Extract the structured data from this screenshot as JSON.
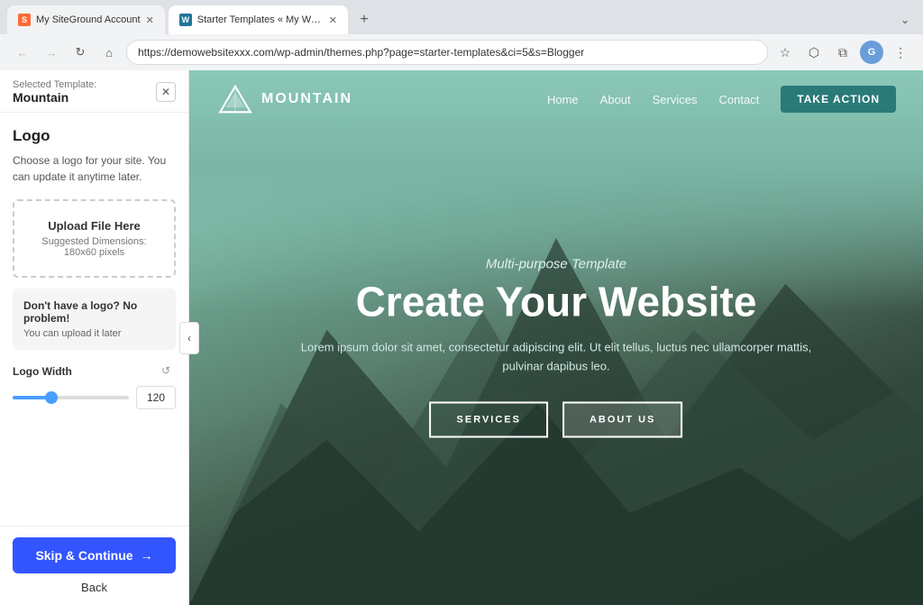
{
  "browser": {
    "tabs": [
      {
        "id": "tab1",
        "label": "My SiteGround Account",
        "active": false,
        "favicon_type": "sg"
      },
      {
        "id": "tab2",
        "label": "Starter Templates « My Word…",
        "active": true,
        "favicon_type": "wp"
      }
    ],
    "new_tab_label": "+",
    "overflow_label": "⌄",
    "address": "https://demowebsitexxx.com/wp-admin/themes.php?page=starter-templates&ci=5&s=Blogger",
    "nav_back": "←",
    "nav_forward": "→",
    "nav_refresh": "↻",
    "nav_home": "⌂",
    "bookmark_icon": "☆",
    "share_icon": "⬡",
    "multiwindow_icon": "⧉",
    "profile_initial": "G",
    "menu_icon": "⋮"
  },
  "sidebar": {
    "template_label": "Selected Template:",
    "template_name": "Mountain",
    "close_btn": "✕",
    "section_title": "Logo",
    "description": "Choose a logo for your site. You can update it anytime later.",
    "upload_title": "Upload File Here",
    "upload_hint": "Suggested Dimensions: 180x60 pixels",
    "no_logo_title": "Don't have a logo? No problem!",
    "no_logo_sub": "You can upload it later",
    "logo_width_label": "Logo Width",
    "logo_width_value": "120",
    "skip_label": "Skip & Continue",
    "skip_arrow": "→",
    "back_label": "Back",
    "collapse_arrow": "‹"
  },
  "site": {
    "logo_text": "MOUNTAIN",
    "nav_links": [
      {
        "label": "Home"
      },
      {
        "label": "About"
      },
      {
        "label": "Services"
      },
      {
        "label": "Contact"
      }
    ],
    "cta_label": "TAKE ACTION",
    "hero_subtitle": "Multi-purpose Template",
    "hero_title": "Create Your Website",
    "hero_desc": "Lorem ipsum dolor sit amet, consectetur adipiscing elit. Ut elit tellus, luctus nec\nullamcorper mattis, pulvinar dapibus leo.",
    "btn1_label": "SERVICES",
    "btn2_label": "ABOUT US"
  }
}
